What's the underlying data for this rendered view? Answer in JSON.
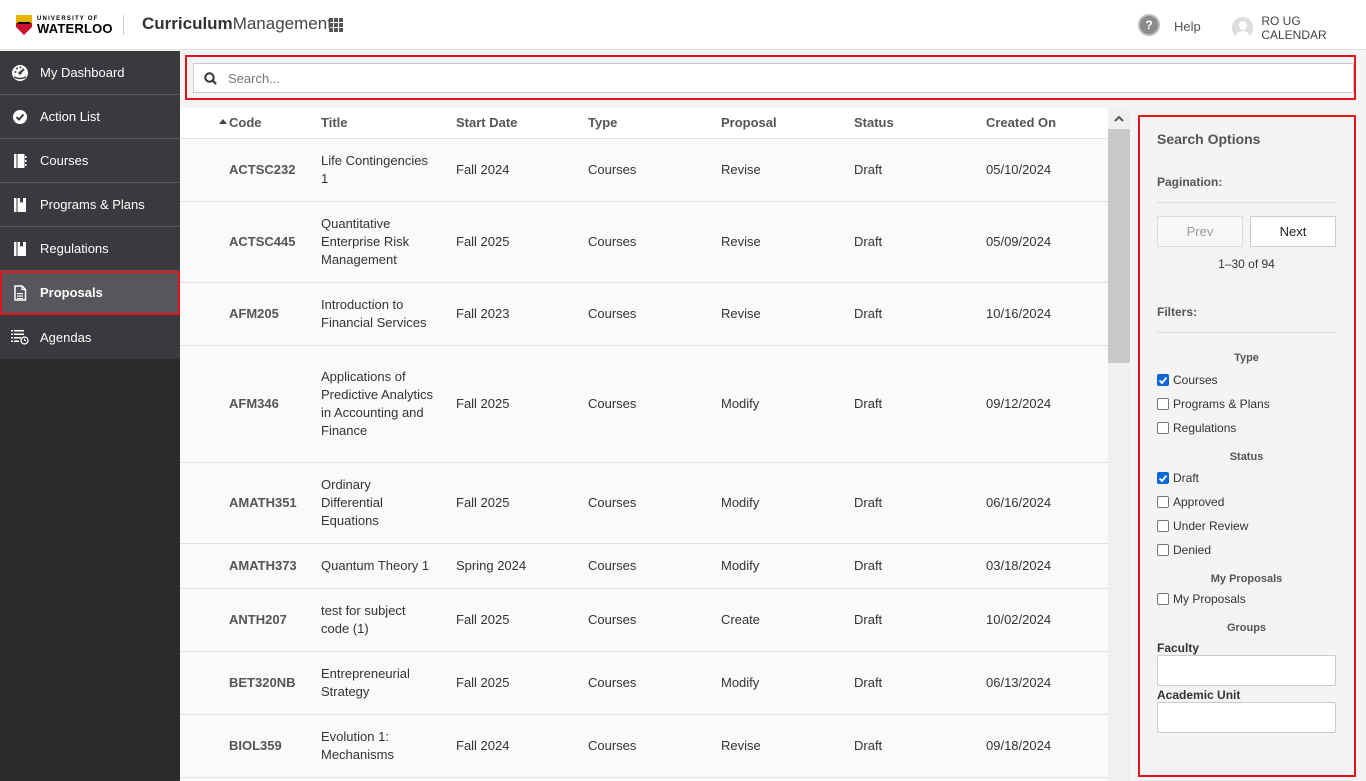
{
  "header": {
    "logo_small": "UNIVERSITY OF",
    "logo_big": "WATERLOO",
    "app_title_bold": "Curriculum",
    "app_title_light": "Management",
    "help_label": "Help",
    "user_label": "RO UG CALENDAR"
  },
  "sidebar": {
    "items": [
      {
        "label": "My Dashboard",
        "icon": "dashboard-icon"
      },
      {
        "label": "Action List",
        "icon": "check-circle-icon"
      },
      {
        "label": "Courses",
        "icon": "book-icon"
      },
      {
        "label": "Programs & Plans",
        "icon": "bookmark-book-icon"
      },
      {
        "label": "Regulations",
        "icon": "bookmark-book-icon"
      },
      {
        "label": "Proposals",
        "icon": "document-icon",
        "active": true
      },
      {
        "label": "Agendas",
        "icon": "agenda-list-clock-icon"
      }
    ]
  },
  "search": {
    "placeholder": "Search...",
    "value": ""
  },
  "table": {
    "columns": [
      "Code",
      "Title",
      "Start Date",
      "Type",
      "Proposal",
      "Status",
      "Created On"
    ],
    "sort_column": "Code",
    "sort_direction": "ascending",
    "rows": [
      {
        "code": "ACTSC232",
        "title": "Life Contingencies 1",
        "start": "Fall 2024",
        "type": "Courses",
        "proposal": "Revise",
        "status": "Draft",
        "created": "05/10/2024"
      },
      {
        "code": "ACTSC445",
        "title": "Quantitative Enterprise Risk Management",
        "start": "Fall 2025",
        "type": "Courses",
        "proposal": "Revise",
        "status": "Draft",
        "created": "05/09/2024"
      },
      {
        "code": "AFM205",
        "title": "Introduction to Financial Services",
        "start": "Fall 2023",
        "type": "Courses",
        "proposal": "Revise",
        "status": "Draft",
        "created": "10/16/2024"
      },
      {
        "code": "AFM346",
        "title": "Applications of Predictive Analytics in Accounting and Finance",
        "start": "Fall 2025",
        "type": "Courses",
        "proposal": "Modify",
        "status": "Draft",
        "created": "09/12/2024"
      },
      {
        "code": "AMATH351",
        "title": "Ordinary Differential Equations",
        "start": "Fall 2025",
        "type": "Courses",
        "proposal": "Modify",
        "status": "Draft",
        "created": "06/16/2024"
      },
      {
        "code": "AMATH373",
        "title": "Quantum Theory 1",
        "start": "Spring 2024",
        "type": "Courses",
        "proposal": "Modify",
        "status": "Draft",
        "created": "03/18/2024"
      },
      {
        "code": "ANTH207",
        "title": "test for subject code (1)",
        "start": "Fall 2025",
        "type": "Courses",
        "proposal": "Create",
        "status": "Draft",
        "created": "10/02/2024"
      },
      {
        "code": "BET320NB",
        "title": "Entrepreneurial Strategy",
        "start": "Fall 2025",
        "type": "Courses",
        "proposal": "Modify",
        "status": "Draft",
        "created": "06/13/2024"
      },
      {
        "code": "BIOL359",
        "title": "Evolution 1: Mechanisms",
        "start": "Fall 2024",
        "type": "Courses",
        "proposal": "Revise",
        "status": "Draft",
        "created": "09/18/2024"
      }
    ]
  },
  "panel": {
    "title": "Search Options",
    "pagination_label": "Pagination:",
    "prev_label": "Prev",
    "next_label": "Next",
    "page_count": "1–30 of 94",
    "filters_label": "Filters:",
    "type_group": {
      "title": "Type",
      "options": [
        {
          "label": "Courses",
          "checked": true
        },
        {
          "label": "Programs & Plans",
          "checked": false
        },
        {
          "label": "Regulations",
          "checked": false
        }
      ]
    },
    "status_group": {
      "title": "Status",
      "options": [
        {
          "label": "Draft",
          "checked": true
        },
        {
          "label": "Approved",
          "checked": false
        },
        {
          "label": "Under Review",
          "checked": false
        },
        {
          "label": "Denied",
          "checked": false
        }
      ]
    },
    "my_proposals_group": {
      "title": "My Proposals",
      "options": [
        {
          "label": "My Proposals",
          "checked": false
        }
      ]
    },
    "groups_title": "Groups",
    "faculty_label": "Faculty",
    "faculty_value": "",
    "academic_unit_label": "Academic Unit",
    "academic_unit_value": ""
  },
  "colors": {
    "highlight_red": "#e3141c",
    "sidebar_bg": "#3a393d",
    "sidebar_active_bg": "#57565b",
    "checkbox_blue": "#0b67d8"
  }
}
